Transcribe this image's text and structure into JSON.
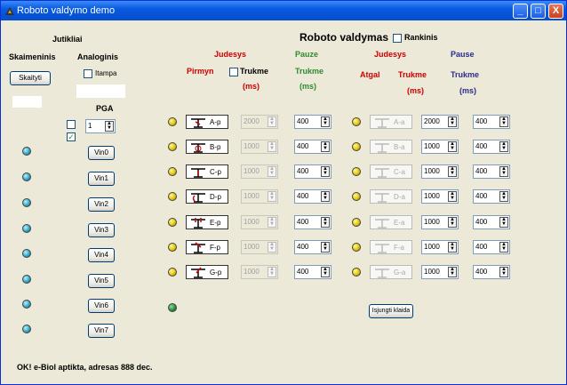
{
  "window": {
    "title": "Roboto valdymo demo",
    "controls": {
      "min": "_",
      "max": "□",
      "close": "X"
    }
  },
  "sensors": {
    "heading": "Jutikliai",
    "digital_label": "Skaimeninis",
    "read_button": "Skaityti",
    "analog_label": "Analoginis",
    "voltage_checkbox": "Itampa",
    "pga_label": "PGA",
    "pga_value": "1",
    "vin_buttons": [
      "Vin0",
      "Vin1",
      "Vin2",
      "Vin3",
      "Vin4",
      "Vin5",
      "Vin6",
      "Vin7"
    ]
  },
  "robot": {
    "heading": "Roboto valdymas",
    "manual_checkbox": "Rankinis",
    "forward": {
      "heading": "Judesys",
      "sub": "Pirmyn",
      "duration": "Trukme",
      "unit": "(ms)"
    },
    "pause1": {
      "heading": "Pauze",
      "duration": "Trukme",
      "unit": "(ms)"
    },
    "backward": {
      "heading": "Judesys",
      "sub": "Atgal",
      "duration": "Trukme",
      "unit": "(ms)"
    },
    "pause2": {
      "heading": "Pause",
      "duration": "Trukme",
      "unit": "(ms)"
    },
    "rows": [
      {
        "fwd_label": "A-p",
        "fwd_time": "2000",
        "pause1": "400",
        "back_label": "A-a",
        "back_time": "2000",
        "pause2": "400"
      },
      {
        "fwd_label": "B-p",
        "fwd_time": "1000",
        "pause1": "400",
        "back_label": "B-a",
        "back_time": "1000",
        "pause2": "400"
      },
      {
        "fwd_label": "C-p",
        "fwd_time": "1000",
        "pause1": "400",
        "back_label": "C-a",
        "back_time": "1000",
        "pause2": "400"
      },
      {
        "fwd_label": "D-p",
        "fwd_time": "1000",
        "pause1": "400",
        "back_label": "D-a",
        "back_time": "1000",
        "pause2": "400"
      },
      {
        "fwd_label": "E-p",
        "fwd_time": "1000",
        "pause1": "400",
        "back_label": "E-a",
        "back_time": "1000",
        "pause2": "400"
      },
      {
        "fwd_label": "F-p",
        "fwd_time": "1000",
        "pause1": "400",
        "back_label": "F-a",
        "back_time": "1000",
        "pause2": "400"
      },
      {
        "fwd_label": "G-p",
        "fwd_time": "1000",
        "pause1": "400",
        "back_label": "G-a",
        "back_time": "1000",
        "pause2": "400"
      }
    ],
    "error_button": "Isjungti klaida"
  },
  "status": "OK! e-Biol aptikta, adresas 888 dec.",
  "colors": {
    "red": "#cc0000",
    "green": "#2e8b2e",
    "navy": "#2b2b8c",
    "titlebar": "#0a5ae0"
  },
  "icons": {
    "led_yellow": "yellow-led-icon",
    "led_teal": "teal-led-icon",
    "led_green": "green-led-icon",
    "actuator": "actuator-icon"
  }
}
